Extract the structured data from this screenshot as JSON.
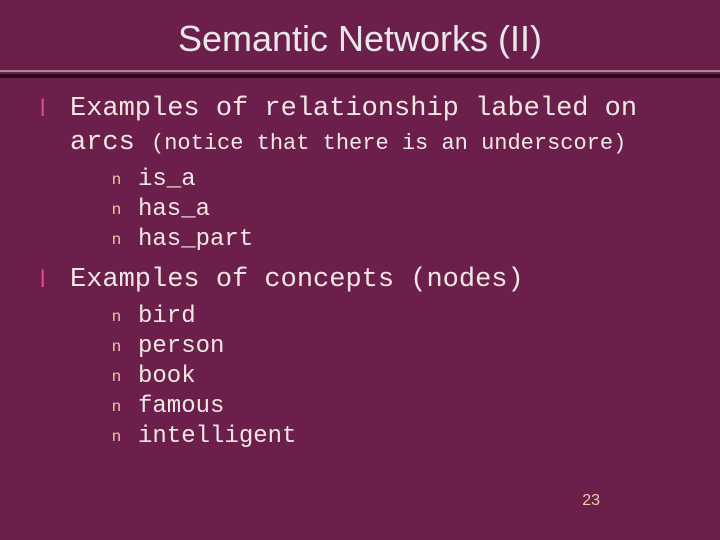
{
  "title": "Semantic Networks (II)",
  "sections": [
    {
      "lead": "Examples of relationship labeled on arcs ",
      "note": "(notice that there is an underscore)",
      "items": [
        "is_a",
        "has_a",
        "has_part"
      ]
    },
    {
      "lead": "Examples of concepts (nodes)",
      "note": "",
      "items": [
        "bird",
        "person",
        "book",
        "famous",
        "intelligent"
      ]
    }
  ],
  "page_number": "23",
  "glyphs": {
    "top": "l",
    "sub": "n"
  }
}
